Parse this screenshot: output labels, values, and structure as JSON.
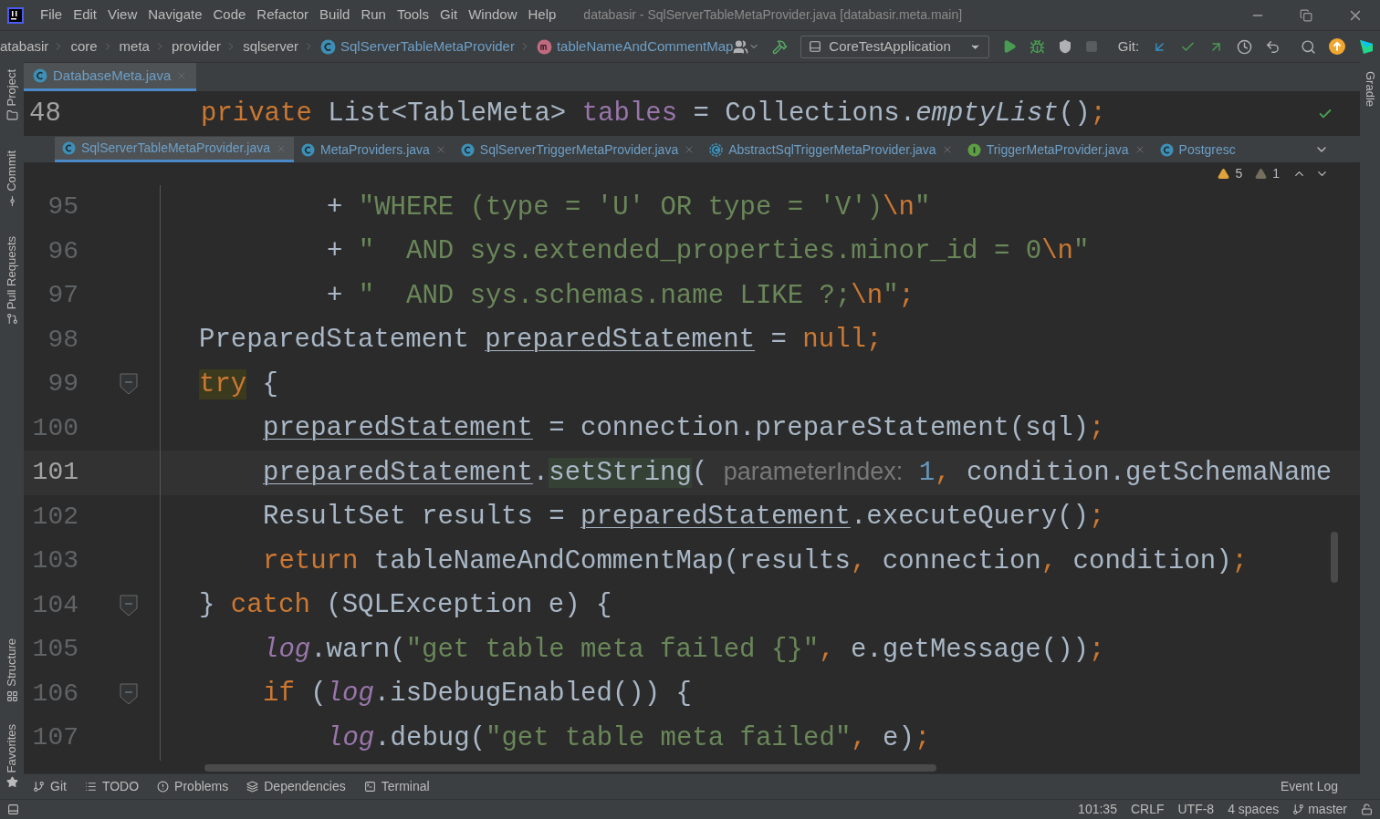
{
  "window": {
    "title": "databasir - SqlServerTableMetaProvider.java [databasir.meta.main]"
  },
  "menu": [
    "File",
    "Edit",
    "View",
    "Navigate",
    "Code",
    "Refactor",
    "Build",
    "Run",
    "Tools",
    "Git",
    "Window",
    "Help"
  ],
  "breadcrumbs": [
    {
      "label": "atabasir",
      "kind": "folder"
    },
    {
      "label": "core",
      "kind": "folder"
    },
    {
      "label": "meta",
      "kind": "folder"
    },
    {
      "label": "provider",
      "kind": "folder"
    },
    {
      "label": "sqlserver",
      "kind": "folder"
    },
    {
      "label": "SqlServerTableMetaProvider",
      "kind": "class"
    },
    {
      "label": "tableNameAndCommentMap",
      "kind": "method"
    }
  ],
  "toolbar": {
    "run_config": "CoreTestApplication",
    "git_label": "Git:"
  },
  "left_tools_top": [
    {
      "label": "Project",
      "kind": "folder"
    },
    {
      "label": "Commit",
      "kind": "commit"
    },
    {
      "label": "Pull Requests",
      "kind": "pull"
    }
  ],
  "left_tools_bottom": [
    {
      "label": "Structure",
      "kind": "structure"
    },
    {
      "label": "Favorites",
      "kind": "star"
    }
  ],
  "right_tools": [
    "Gradle"
  ],
  "top_tabs": [
    {
      "label": "DatabaseMeta.java",
      "kind": "class",
      "selected": true
    }
  ],
  "sticky_line": {
    "number": "48",
    "tokens": [
      {
        "text": "private",
        "kind": "keyword"
      },
      {
        "text": " List<TableMeta> ",
        "kind": "plain"
      },
      {
        "text": "tables",
        "kind": "field"
      },
      {
        "text": " = Collections.",
        "kind": "plain"
      },
      {
        "text": "emptyList",
        "kind": "static-method"
      },
      {
        "text": "()",
        "kind": "plain"
      },
      {
        "text": ";",
        "kind": "keyword"
      }
    ]
  },
  "editor_tabs": [
    {
      "label": "SqlServerTableMetaProvider.java",
      "kind": "class",
      "selected": true,
      "closable": true
    },
    {
      "label": "MetaProviders.java",
      "kind": "class",
      "selected": false,
      "closable": true
    },
    {
      "label": "SqlServerTriggerMetaProvider.java",
      "kind": "class",
      "selected": false,
      "closable": true
    },
    {
      "label": "AbstractSqlTriggerMetaProvider.java",
      "kind": "abstract",
      "selected": false,
      "closable": true
    },
    {
      "label": "TriggerMetaProvider.java",
      "kind": "interface",
      "selected": false,
      "closable": true
    },
    {
      "label": "Postgresc",
      "kind": "class",
      "selected": false,
      "closable": false
    }
  ],
  "inspections": {
    "warnings": "5",
    "weak_warnings": "1"
  },
  "lines": [
    {
      "number": "95",
      "kind": "continuation",
      "current": false,
      "fold": false,
      "tokens": [
        {
          "text": "+ ",
          "kind": "plain"
        },
        {
          "text": "\"WHERE (type = 'U' OR type = 'V')",
          "kind": "string"
        },
        {
          "text": "\\n",
          "kind": "escape"
        },
        {
          "text": "\"",
          "kind": "string"
        }
      ]
    },
    {
      "number": "96",
      "kind": "continuation",
      "current": false,
      "fold": false,
      "tokens": [
        {
          "text": "+ ",
          "kind": "plain"
        },
        {
          "text": "\"  AND sys.extended_properties.minor_id = 0",
          "kind": "string"
        },
        {
          "text": "\\n",
          "kind": "escape"
        },
        {
          "text": "\"",
          "kind": "string"
        }
      ]
    },
    {
      "number": "97",
      "kind": "continuation",
      "current": false,
      "fold": false,
      "tokens": [
        {
          "text": "+ ",
          "kind": "plain"
        },
        {
          "text": "\"  AND sys.schemas.name LIKE ?;",
          "kind": "string"
        },
        {
          "text": "\\n",
          "kind": "escape"
        },
        {
          "text": "\"",
          "kind": "string"
        },
        {
          "text": ";",
          "kind": "keyword"
        }
      ]
    },
    {
      "number": "98",
      "kind": "statement",
      "current": false,
      "fold": false,
      "tokens": [
        {
          "text": "PreparedStatement ",
          "kind": "plain"
        },
        {
          "text": "preparedStatement",
          "kind": "var"
        },
        {
          "text": " = ",
          "kind": "plain"
        },
        {
          "text": "null;",
          "kind": "keyword"
        }
      ]
    },
    {
      "number": "99",
      "kind": "statement",
      "current": false,
      "fold": true,
      "tokens": [
        {
          "text": "try",
          "kind": "keyword-hl"
        },
        {
          "text": " {",
          "kind": "plain"
        }
      ],
      "children": [
        {
          "number": "100",
          "kind": "statement",
          "current": false,
          "fold": false,
          "tokens": [
            {
              "text": "preparedStatement",
              "kind": "var"
            },
            {
              "text": " = connection.prepareStatement(sql)",
              "kind": "plain"
            },
            {
              "text": ";",
              "kind": "keyword"
            }
          ]
        },
        {
          "number": "101",
          "kind": "statement",
          "current": true,
          "fold": false,
          "tokens": [
            {
              "text": "preparedStatement",
              "kind": "var"
            },
            {
              "text": ".",
              "kind": "plain"
            },
            {
              "text": "setString",
              "kind": "match"
            },
            {
              "text": "( ",
              "kind": "plain"
            },
            {
              "text": "parameterIndex:",
              "kind": "hint"
            },
            {
              "text": " 1",
              "kind": "number"
            },
            {
              "text": ",",
              "kind": "keyword"
            },
            {
              "text": " condition.getSchemaName",
              "kind": "plain"
            }
          ]
        },
        {
          "number": "102",
          "kind": "statement",
          "current": false,
          "fold": false,
          "tokens": [
            {
              "text": "ResultSet results = ",
              "kind": "plain"
            },
            {
              "text": "preparedStatement",
              "kind": "var"
            },
            {
              "text": ".executeQuery()",
              "kind": "plain"
            },
            {
              "text": ";",
              "kind": "keyword"
            }
          ]
        },
        {
          "number": "103",
          "kind": "statement",
          "current": false,
          "fold": false,
          "tokens": [
            {
              "text": "return",
              "kind": "keyword"
            },
            {
              "text": " tableNameAndCommentMap(results",
              "kind": "plain"
            },
            {
              "text": ",",
              "kind": "keyword"
            },
            {
              "text": " connection",
              "kind": "plain"
            },
            {
              "text": ",",
              "kind": "keyword"
            },
            {
              "text": " condition)",
              "kind": "plain"
            },
            {
              "text": ";",
              "kind": "keyword"
            }
          ]
        }
      ]
    },
    {
      "number": "104",
      "kind": "statement",
      "current": false,
      "fold": true,
      "tokens": [
        {
          "text": "} ",
          "kind": "plain"
        },
        {
          "text": "catch",
          "kind": "keyword"
        },
        {
          "text": " (SQLException e) {",
          "kind": "plain"
        }
      ],
      "children": [
        {
          "number": "105",
          "kind": "statement",
          "current": false,
          "fold": false,
          "tokens": [
            {
              "text": "log",
              "kind": "static-field"
            },
            {
              "text": ".warn(",
              "kind": "plain"
            },
            {
              "text": "\"get table meta failed {}\"",
              "kind": "string"
            },
            {
              "text": ",",
              "kind": "keyword"
            },
            {
              "text": " e.getMessage())",
              "kind": "plain"
            },
            {
              "text": ";",
              "kind": "keyword"
            }
          ]
        },
        {
          "number": "106",
          "kind": "statement",
          "current": false,
          "fold": true,
          "tokens": [
            {
              "text": "if",
              "kind": "keyword"
            },
            {
              "text": " (",
              "kind": "plain"
            },
            {
              "text": "log",
              "kind": "static-field"
            },
            {
              "text": ".isDebugEnabled()) {",
              "kind": "plain"
            }
          ],
          "children": [
            {
              "number": "107",
              "kind": "statement",
              "current": false,
              "fold": false,
              "tokens": [
                {
                  "text": "log",
                  "kind": "static-field"
                },
                {
                  "text": ".debug(",
                  "kind": "plain"
                },
                {
                  "text": "\"get table meta failed\"",
                  "kind": "string"
                },
                {
                  "text": ",",
                  "kind": "keyword"
                },
                {
                  "text": " e)",
                  "kind": "plain"
                },
                {
                  "text": ";",
                  "kind": "keyword"
                }
              ]
            }
          ]
        }
      ]
    }
  ],
  "bottom_tools": [
    {
      "label": "Git",
      "kind": "branch"
    },
    {
      "label": "TODO",
      "kind": "list"
    },
    {
      "label": "Problems",
      "kind": "problem"
    },
    {
      "label": "Dependencies",
      "kind": "layers"
    },
    {
      "label": "Terminal",
      "kind": "terminal"
    }
  ],
  "event_log": "Event Log",
  "status": {
    "position": "101:35",
    "line_sep": "CRLF",
    "encoding": "UTF-8",
    "indent": "4 spaces",
    "branch": "master"
  }
}
